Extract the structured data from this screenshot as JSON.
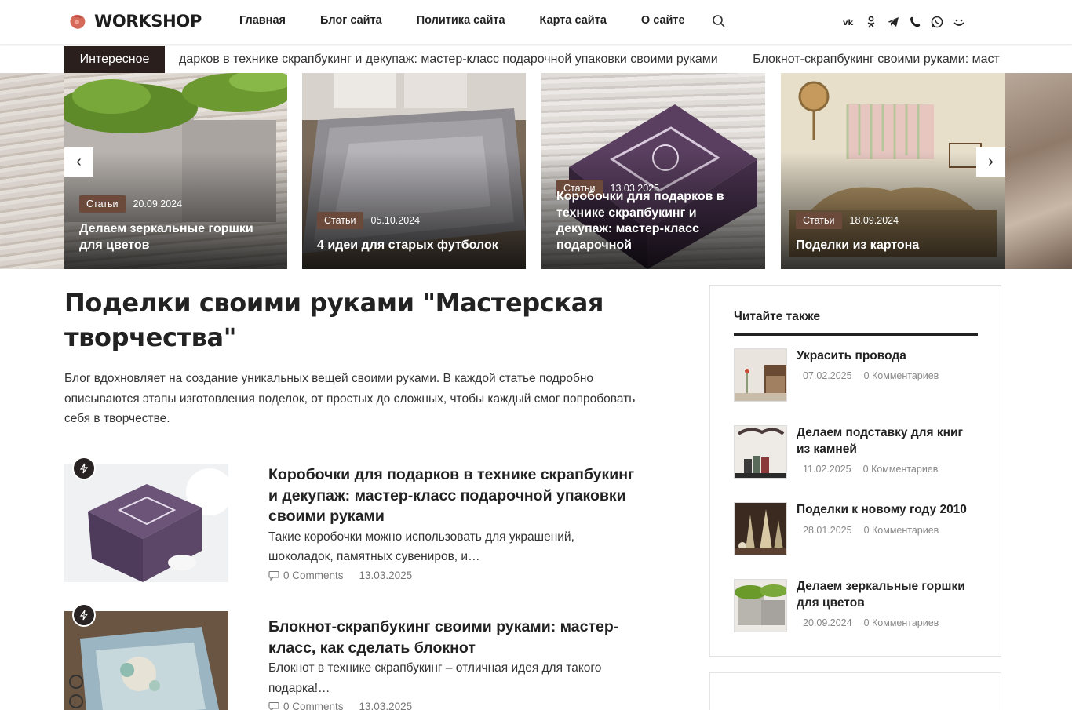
{
  "header": {
    "logo_text": "WORKSHOP",
    "nav": [
      "Главная",
      "Блог сайта",
      "Политика сайта",
      "Карта сайта",
      "О сайте"
    ],
    "icons": [
      "search-icon",
      "vk-icon",
      "odnoklassniki-icon",
      "telegram-icon",
      "viber-icon",
      "whatsapp-icon",
      "moimir-icon"
    ]
  },
  "ticker": {
    "label": "Интересное",
    "items": [
      "дарков в технике скрапбукинг и декупаж: мастер-класс подарочной упаковки своими руками",
      "Блокнот-скрапбукинг своими руками: маст"
    ]
  },
  "slider": {
    "prev": "‹",
    "next": "›",
    "slides": [
      {
        "badge": "Статьи",
        "date": "20.09.2024",
        "title": "Делаем зеркальные горшки для цветов"
      },
      {
        "badge": "Статьи",
        "date": "05.10.2024",
        "title": "4 идеи для старых футболок"
      },
      {
        "badge": "Статьи",
        "date": "13.03.2025",
        "title": "Коробочки для подарков в технике скрапбукинг и декупаж: мастер-класс подарочной"
      },
      {
        "badge": "Статьи",
        "date": "18.09.2024",
        "title": "Поделки из картона"
      }
    ]
  },
  "main": {
    "title": "Поделки своими руками \"Мастерская творчества\"",
    "intro": "Блог вдохновляет на создание уникальных вещей своими руками. В каждой статье подробно описываются этапы изготовления поделок, от простых до сложных, чтобы каждый смог попробовать себя в творчестве.",
    "posts": [
      {
        "title": "Коробочки для подарков в технике скрапбукинг и декупаж: мастер-класс подарочной упаковки своими руками",
        "excerpt": "Такие коробочки можно использовать для украшений, шоколадок, памятных сувениров, и…",
        "comments": "0 Comments",
        "date": "13.03.2025"
      },
      {
        "title": "Блокнот-скрапбукинг своими руками: мастер-класс, как сделать блокнот",
        "excerpt": "Блокнот в технике скрапбукинг – отличная идея для такого подарка!…",
        "comments": "0 Comments",
        "date": "13.03.2025"
      }
    ]
  },
  "sidebar": {
    "title": "Читайте также",
    "items": [
      {
        "title": "Украсить провода",
        "date": "07.02.2025",
        "comments": "0 Комментариев"
      },
      {
        "title": "Делаем подставку для книг из камней",
        "date": "11.02.2025",
        "comments": "0 Комментариев"
      },
      {
        "title": "Поделки к новому году 2010",
        "date": "28.01.2025",
        "comments": "0 Комментариев"
      },
      {
        "title": "Делаем зеркальные горшки для цветов",
        "date": "20.09.2024",
        "comments": "0 Комментариев"
      }
    ]
  },
  "colors": {
    "accent": "#6b4a3c",
    "dark": "#2a1f1c"
  }
}
